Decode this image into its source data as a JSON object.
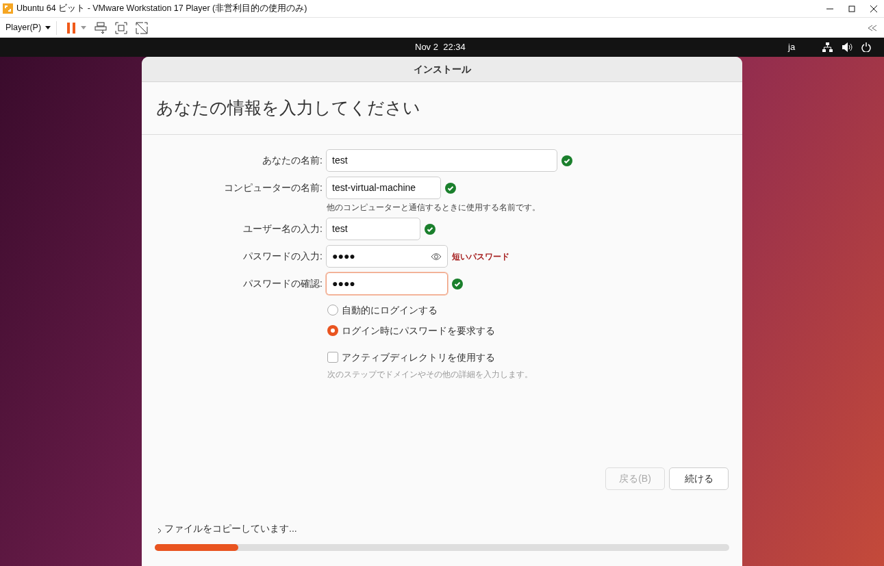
{
  "window": {
    "title": "Ubuntu 64 ビット - VMware Workstation 17 Player (非営利目的の使用のみ)"
  },
  "toolbar": {
    "player_menu": "Player(P)"
  },
  "top_bar": {
    "clock": "Nov 2  22:34",
    "input_method": "ja"
  },
  "dialog": {
    "title": "インストール",
    "heading": "あなたの情報を入力してください",
    "fields": [
      {
        "kind": "text",
        "label": "あなたの名前:",
        "value": "test",
        "valid": true,
        "focused": false
      },
      {
        "kind": "text",
        "label": "コンピューターの名前:",
        "value": "test-virtual-machine",
        "valid": true,
        "focused": false,
        "hint": "他のコンピューターと通信するときに使用する名前です。"
      },
      {
        "kind": "text",
        "label": "ユーザー名の入力:",
        "value": "test",
        "valid": true,
        "focused": false
      },
      {
        "kind": "password",
        "label": "パスワードの入力:",
        "value": "●●●●",
        "valid": false,
        "message": "短いパスワード",
        "focused": false
      },
      {
        "kind": "text",
        "label": "パスワードの確認:",
        "value": "●●●●",
        "valid": true,
        "focused": true
      }
    ],
    "login_options": [
      {
        "label": "自動的にログインする",
        "selected": false
      },
      {
        "label": "ログイン時にパスワードを要求する",
        "selected": true
      }
    ],
    "active_directory": {
      "label": "アクティブディレクトリを使用する",
      "checked": false,
      "hint": "次のステップでドメインやその他の詳細を入力します。"
    },
    "buttons": [
      {
        "label": "戻る(B)",
        "disabled": true
      },
      {
        "label": "続ける",
        "disabled": false
      }
    ],
    "progress": {
      "text": "ファイルをコピーしています...",
      "level": 0.146
    }
  }
}
